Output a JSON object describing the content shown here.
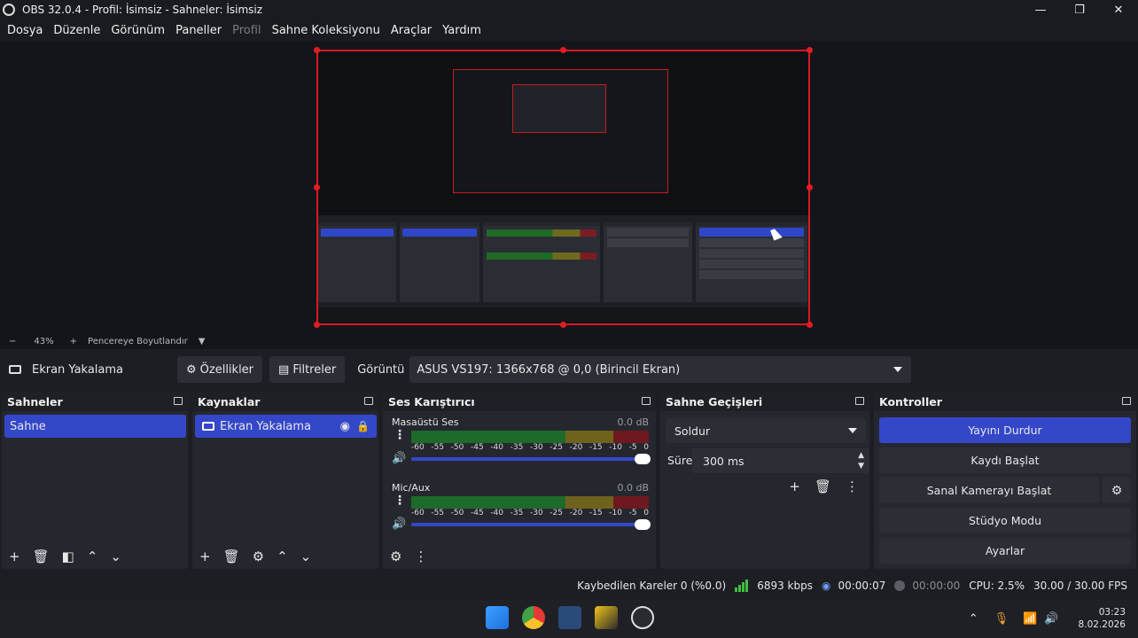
{
  "window": {
    "title": "OBS 32.0.4 - Profil: İsimsiz - Sahneler: İsimsiz",
    "minimize": "—",
    "maximize": "❐",
    "close": "✕"
  },
  "menu": [
    "Dosya",
    "Düzenle",
    "Görünüm",
    "Paneller",
    "Profil",
    "Sahne Koleksiyonu",
    "Araçlar",
    "Yardım"
  ],
  "zoom": {
    "minus": "−",
    "value": "43%",
    "plus": "+",
    "fit_label": "Pencereye Boyutlandır"
  },
  "source_toolbar": {
    "source_name": "Ekran Yakalama",
    "properties": "Özellikler",
    "filters": "Filtreler",
    "display_label": "Görüntü",
    "display_value": "ASUS VS197: 1366x768 @ 0,0 (Birincil Ekran)"
  },
  "scenes": {
    "title": "Sahneler",
    "items": [
      "Sahne"
    ]
  },
  "sources": {
    "title": "Kaynaklar",
    "items": [
      "Ekran Yakalama"
    ]
  },
  "mixer": {
    "title": "Ses Karıştırıcı",
    "channels": [
      {
        "name": "Masaüstü Ses",
        "db": "0.0 dB"
      },
      {
        "name": "Mic/Aux",
        "db": "0.0 dB"
      }
    ],
    "ticks": [
      "-60",
      "-55",
      "-50",
      "-45",
      "-40",
      "-35",
      "-30",
      "-25",
      "-20",
      "-15",
      "-10",
      "-5",
      "0"
    ]
  },
  "transitions": {
    "title": "Sahne Geçişleri",
    "selected": "Soldur",
    "duration_label": "Süre",
    "duration_value": "300 ms"
  },
  "controls": {
    "title": "Kontroller",
    "stop_stream": "Yayını Durdur",
    "start_record": "Kaydı Başlat",
    "virtual_cam": "Sanal Kamerayı Başlat",
    "studio_mode": "Stüdyo Modu",
    "settings": "Ayarlar"
  },
  "status": {
    "dropped": "Kaybedilen Kareler 0 (%0.0)",
    "bitrate": "6893 kbps",
    "stream_time": "00:00:07",
    "record_time": "00:00:00",
    "cpu": "CPU: 2.5%",
    "fps": "30.00 / 30.00 FPS"
  },
  "clock": {
    "time": "03:23",
    "date": "8.02.2026"
  },
  "colors": {
    "accent": "#3447c9",
    "preview_border": "#d8191f",
    "meter_green": "#1d6a2a",
    "meter_yellow": "#6e621c",
    "meter_red": "#6e1820"
  }
}
